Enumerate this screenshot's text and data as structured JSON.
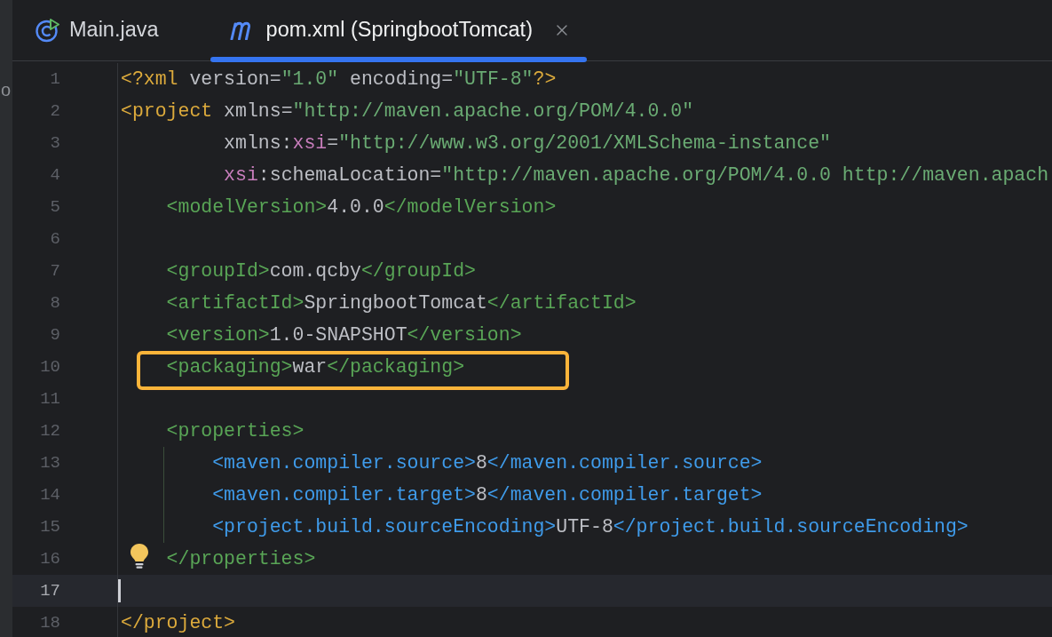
{
  "left_strip": {
    "text": "o"
  },
  "tabs": [
    {
      "label": "Main.java",
      "kind": "java",
      "selected": false
    },
    {
      "label": "pom.xml (SpringbootTomcat)",
      "kind": "maven",
      "selected": true
    }
  ],
  "editor": {
    "lines": [
      {
        "number": "1",
        "kind": "top",
        "current": false,
        "highlighted": false,
        "bulb": false,
        "segments": [
          {
            "kind": "root",
            "text": "<?xml"
          },
          {
            "kind": "attr",
            "text": " version="
          },
          {
            "kind": "value",
            "text": "\"1.0\""
          },
          {
            "kind": "attr",
            "text": " encoding="
          },
          {
            "kind": "value",
            "text": "\"UTF-8\""
          },
          {
            "kind": "root",
            "text": "?>"
          }
        ]
      },
      {
        "number": "2",
        "kind": "top",
        "current": false,
        "highlighted": false,
        "bulb": false,
        "segments": [
          {
            "kind": "root",
            "text": "<project"
          },
          {
            "kind": "attr",
            "text": " xmlns="
          },
          {
            "kind": "value",
            "text": "\"http://maven.apache.org/POM/4.0.0\""
          }
        ]
      },
      {
        "number": "3",
        "kind": "continuation",
        "current": false,
        "highlighted": false,
        "bulb": false,
        "segments": [
          {
            "kind": "attr",
            "text": "xmlns:"
          },
          {
            "kind": "ns",
            "text": "xsi"
          },
          {
            "kind": "attr",
            "text": "="
          },
          {
            "kind": "value",
            "text": "\"http://www.w3.org/2001/XMLSchema-instance\""
          }
        ]
      },
      {
        "number": "4",
        "kind": "continuation",
        "current": false,
        "highlighted": false,
        "bulb": false,
        "segments": [
          {
            "kind": "ns",
            "text": "xsi"
          },
          {
            "kind": "attr",
            "text": ":schemaLocation="
          },
          {
            "kind": "value",
            "text": "\"http://maven.apache.org/POM/4.0.0 http://maven.apach"
          }
        ]
      },
      {
        "number": "5",
        "kind": "child",
        "current": false,
        "highlighted": false,
        "bulb": false,
        "segments": [
          {
            "kind": "tag",
            "text": "<modelVersion>"
          },
          {
            "kind": "text",
            "text": "4.0.0"
          },
          {
            "kind": "tag",
            "text": "</modelVersion>"
          }
        ]
      },
      {
        "number": "6",
        "kind": "top",
        "current": false,
        "highlighted": false,
        "bulb": false
      },
      {
        "number": "7",
        "kind": "child",
        "current": false,
        "highlighted": false,
        "bulb": false,
        "segments": [
          {
            "kind": "tag",
            "text": "<groupId>"
          },
          {
            "kind": "text",
            "text": "com.qcby"
          },
          {
            "kind": "tag",
            "text": "</groupId>"
          }
        ]
      },
      {
        "number": "8",
        "kind": "child",
        "current": false,
        "highlighted": false,
        "bulb": false,
        "segments": [
          {
            "kind": "tag",
            "text": "<artifactId>"
          },
          {
            "kind": "text",
            "text": "SpringbootTomcat"
          },
          {
            "kind": "tag",
            "text": "</artifactId>"
          }
        ]
      },
      {
        "number": "9",
        "kind": "child",
        "current": false,
        "highlighted": false,
        "bulb": false,
        "segments": [
          {
            "kind": "tag",
            "text": "<version>"
          },
          {
            "kind": "text",
            "text": "1.0-SNAPSHOT"
          },
          {
            "kind": "tag",
            "text": "</version>"
          }
        ]
      },
      {
        "number": "10",
        "kind": "child",
        "current": false,
        "highlighted": true,
        "bulb": false,
        "segments": [
          {
            "kind": "tag",
            "text": "<packaging>"
          },
          {
            "kind": "text",
            "text": "war"
          },
          {
            "kind": "tag",
            "text": "</packaging>"
          }
        ]
      },
      {
        "number": "11",
        "kind": "top",
        "current": false,
        "highlighted": false,
        "bulb": false
      },
      {
        "number": "12",
        "kind": "child",
        "current": false,
        "highlighted": false,
        "bulb": false,
        "segments": [
          {
            "kind": "tag",
            "text": "<properties>"
          }
        ]
      },
      {
        "number": "13",
        "kind": "grandchild",
        "current": false,
        "highlighted": false,
        "bulb": false,
        "segments": [
          {
            "kind": "inner",
            "text": "<maven.compiler.source>"
          },
          {
            "kind": "text",
            "text": "8"
          },
          {
            "kind": "inner",
            "text": "</maven.compiler.source>"
          }
        ]
      },
      {
        "number": "14",
        "kind": "grandchild",
        "current": false,
        "highlighted": false,
        "bulb": false,
        "segments": [
          {
            "kind": "inner",
            "text": "<maven.compiler.target>"
          },
          {
            "kind": "text",
            "text": "8"
          },
          {
            "kind": "inner",
            "text": "</maven.compiler.target>"
          }
        ]
      },
      {
        "number": "15",
        "kind": "grandchild",
        "current": false,
        "highlighted": false,
        "bulb": false,
        "segments": [
          {
            "kind": "inner",
            "text": "<project.build.sourceEncoding>"
          },
          {
            "kind": "text",
            "text": "UTF-8"
          },
          {
            "kind": "inner",
            "text": "</project.build.sourceEncoding>"
          }
        ]
      },
      {
        "number": "16",
        "kind": "child",
        "current": false,
        "highlighted": false,
        "bulb": true,
        "segments": [
          {
            "kind": "tag",
            "text": "</properties>"
          }
        ]
      },
      {
        "number": "17",
        "kind": "top",
        "current": true,
        "highlighted": false,
        "bulb": false
      },
      {
        "number": "18",
        "kind": "top",
        "current": false,
        "highlighted": false,
        "bulb": false,
        "segments": [
          {
            "kind": "root",
            "text": "</project>"
          }
        ]
      }
    ]
  }
}
